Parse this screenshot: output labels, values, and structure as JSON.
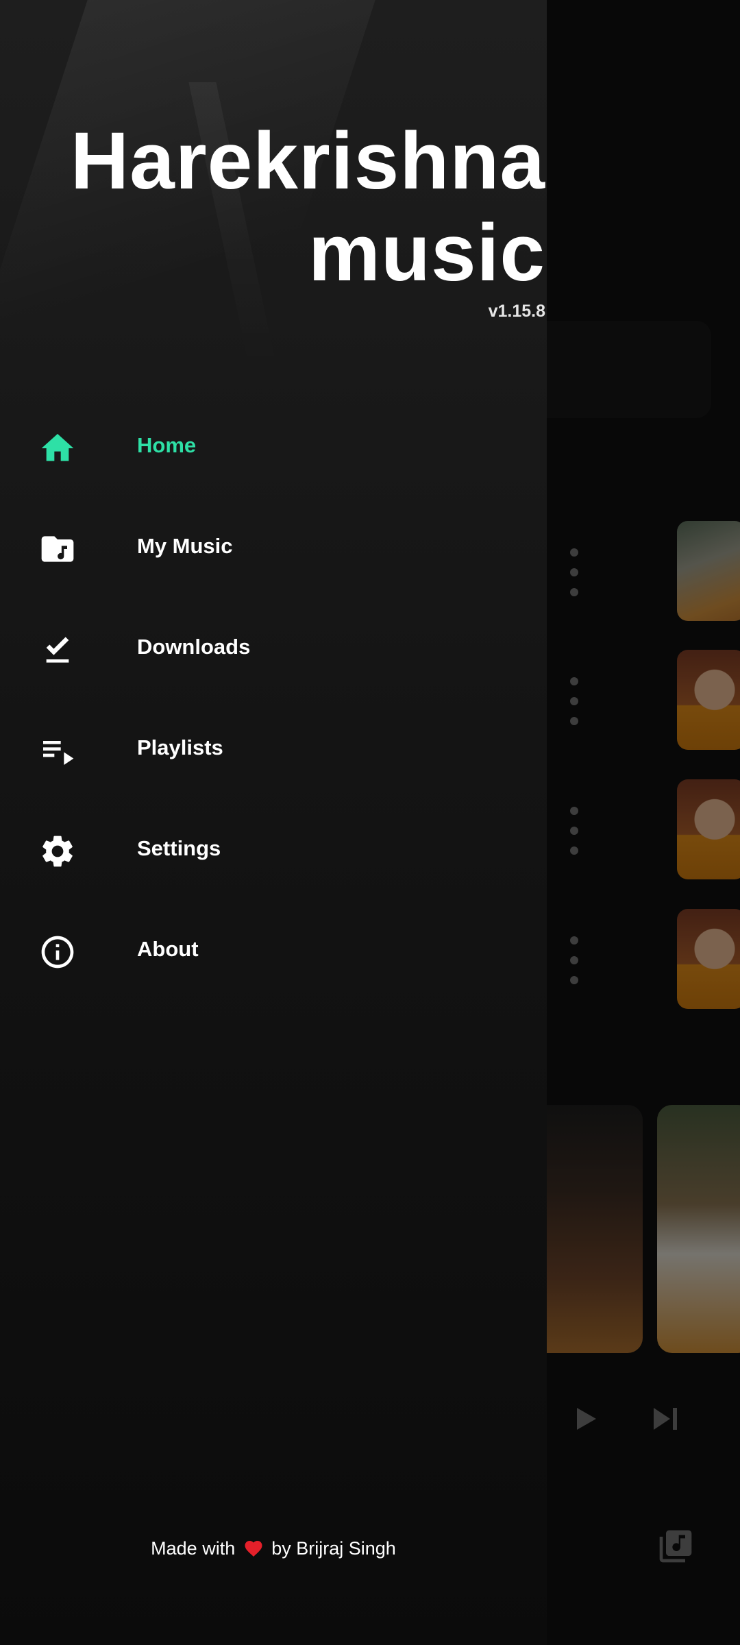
{
  "app": {
    "title": "Harekrishnamusic",
    "version": "v1.15.8"
  },
  "nav": {
    "items": [
      {
        "label": "Home",
        "icon": "home-icon",
        "active": true
      },
      {
        "label": "My Music",
        "icon": "music-folder-icon",
        "active": false
      },
      {
        "label": "Downloads",
        "icon": "download-done-icon",
        "active": false
      },
      {
        "label": "Playlists",
        "icon": "playlist-play-icon",
        "active": false
      },
      {
        "label": "Settings",
        "icon": "settings-gear-icon",
        "active": false
      },
      {
        "label": "About",
        "icon": "info-icon",
        "active": false
      }
    ]
  },
  "footer": {
    "prefix": "Made with",
    "suffix": "by Brijraj Singh"
  },
  "colors": {
    "accent": "#2ee0a6",
    "heart": "#e5202a",
    "drawer_bg": "#141414",
    "text": "#ffffff"
  },
  "background": {
    "controls": [
      "play-icon",
      "skip-next-icon"
    ],
    "library_icon": "music-library-icon"
  }
}
